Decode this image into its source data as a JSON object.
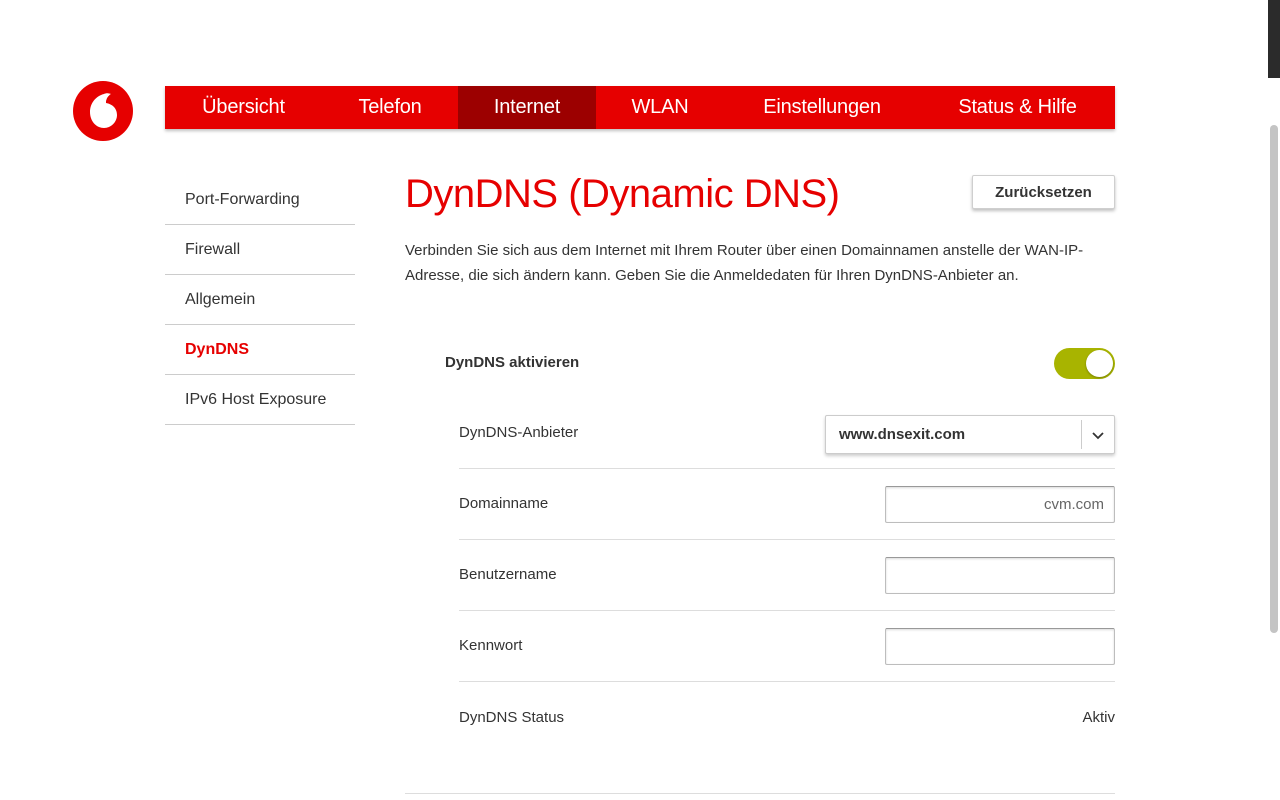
{
  "brand": {
    "logo_icon": "vodafone-logo-icon",
    "accent_color": "#e60000",
    "active_nav_color": "#9c0000",
    "toggle_on_color": "#a8b400"
  },
  "topnav": {
    "items": [
      {
        "label": "Übersicht",
        "active": false
      },
      {
        "label": "Telefon",
        "active": false
      },
      {
        "label": "Internet",
        "active": true
      },
      {
        "label": "WLAN",
        "active": false
      },
      {
        "label": "Einstellungen",
        "active": false
      },
      {
        "label": "Status & Hilfe",
        "active": false
      }
    ]
  },
  "sidebar": {
    "items": [
      {
        "label": "Port-Forwarding",
        "active": false
      },
      {
        "label": "Firewall",
        "active": false
      },
      {
        "label": "Allgemein",
        "active": false
      },
      {
        "label": "DynDNS",
        "active": true
      },
      {
        "label": "IPv6 Host Exposure",
        "active": false
      }
    ]
  },
  "main": {
    "title": "DynDNS (Dynamic DNS)",
    "reset_label": "Zurücksetzen",
    "description": "Verbinden Sie sich aus dem Internet mit Ihrem Router über einen Domainnamen anstelle der WAN-IP-Adresse, die sich ändern kann. Geben Sie die Anmeldedaten für Ihren DynDNS-Anbieter an.",
    "toggle": {
      "label": "DynDNS aktivieren",
      "state": "on"
    },
    "form": {
      "provider_label": "DynDNS-Anbieter",
      "provider_value": "www.dnsexit.com",
      "domain_label": "Domainname",
      "domain_value": "cvm.com",
      "username_label": "Benutzername",
      "username_value": "",
      "password_label": "Kennwort",
      "password_value": ""
    },
    "status": {
      "label": "DynDNS Status",
      "value": "Aktiv"
    }
  }
}
